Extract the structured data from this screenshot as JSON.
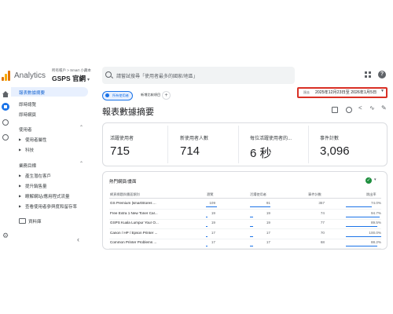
{
  "header": {
    "brand": "Analytics",
    "account_path": "所有帳戶 > Smart 小藏本",
    "account_name": "GSPS 官網",
    "search_placeholder": "請嘗試搜尋「使用者最多的國家/地區」"
  },
  "nav": {
    "selected": "報表數據摘要",
    "items": [
      "即時總覽",
      "即時網頁"
    ],
    "sections": [
      {
        "label": "使用者",
        "items": [
          "使用者屬性",
          "科技"
        ]
      },
      {
        "label": "業務目標",
        "items": [
          "產生潛在客戶",
          "提升銷售量",
          "瞭解網站/應用程式流量",
          "查看使用者參與度和留存率"
        ]
      }
    ],
    "library": "資料庫"
  },
  "toolbar": {
    "chip_all_users": "所有使用者",
    "chip_compare": "新增比較項目",
    "date_prefix": "過去",
    "date_range": "2025年12月23日至 2026年1月5日"
  },
  "page_title": "報表數據摘要",
  "kpis": [
    {
      "label": "活躍使用者",
      "value": "715"
    },
    {
      "label": "新使用者人數",
      "value": "714"
    },
    {
      "label": "每位活躍使用者的...",
      "value": "6 秒"
    },
    {
      "label": "事件計數",
      "value": "3,096"
    }
  ],
  "table": {
    "title": "熱門網頁/畫面",
    "headers": [
      "網頁標題與畫面類別",
      "瀏覽",
      "活躍使用者",
      "事件計數",
      "跳出率"
    ],
    "rows": [
      {
        "title": "GS Premium |smartStores ...",
        "views": "109",
        "users": "91",
        "events": "357",
        "bounce": "74.0%",
        "bar": 1.0
      },
      {
        "title": "Free Extra 1 New Toner Car...",
        "views": "19",
        "users": "19",
        "events": "74",
        "bounce": "94.7%",
        "bar": 0.17
      },
      {
        "title": "GSPS Kuala Lumpur Your O...",
        "views": "19",
        "users": "19",
        "events": "77",
        "bounce": "89.5%",
        "bar": 0.17
      },
      {
        "title": "Canon / HP / Epson Printer ...",
        "views": "17",
        "users": "17",
        "events": "70",
        "bounce": "100.0%",
        "bar": 0.16
      },
      {
        "title": "Common Printer Problems ...",
        "views": "17",
        "users": "17",
        "events": "68",
        "bounce": "88.2%",
        "bar": 0.16
      }
    ]
  },
  "colors": {
    "accent": "#1a73e8",
    "highlight_border": "#d93025",
    "selected_nav_bg": "#e8f0fe",
    "success": "#1e8e3e"
  },
  "icons": [
    "analytics-logo-icon",
    "search-icon",
    "apps-grid-icon",
    "help-icon",
    "home-icon",
    "reports-icon",
    "explore-icon",
    "advertising-icon",
    "gear-icon",
    "check-icon"
  ]
}
